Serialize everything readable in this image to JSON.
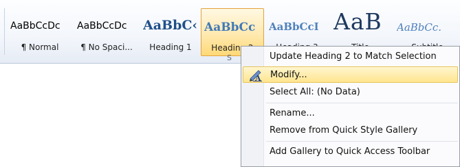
{
  "styles": [
    {
      "sample": "AaBbCcDc",
      "label": "¶ Normal"
    },
    {
      "sample": "AaBbCcDc",
      "label": "¶ No Spaci..."
    },
    {
      "sample": "AaBbC‹",
      "label": "Heading 1"
    },
    {
      "sample": "AaBbCc",
      "label": "Heading 2"
    },
    {
      "sample": "AaBbCcI",
      "label": "Heading 3"
    },
    {
      "sample": "AaB",
      "label": "Title"
    },
    {
      "sample": "AaBbCc.",
      "label": "Subtitle"
    }
  ],
  "group_label": "S",
  "menu": {
    "items": [
      {
        "label": "Update Heading 2 to Match Selection"
      },
      {
        "label": "Modify...",
        "icon": "modify-style-icon"
      },
      {
        "label": "Select All: (No Data)"
      },
      {
        "label": "Rename..."
      },
      {
        "label": "Remove from Quick Style Gallery"
      },
      {
        "label": "Add Gallery to Quick Access Toolbar"
      }
    ],
    "highlighted_item": "Modify..."
  }
}
